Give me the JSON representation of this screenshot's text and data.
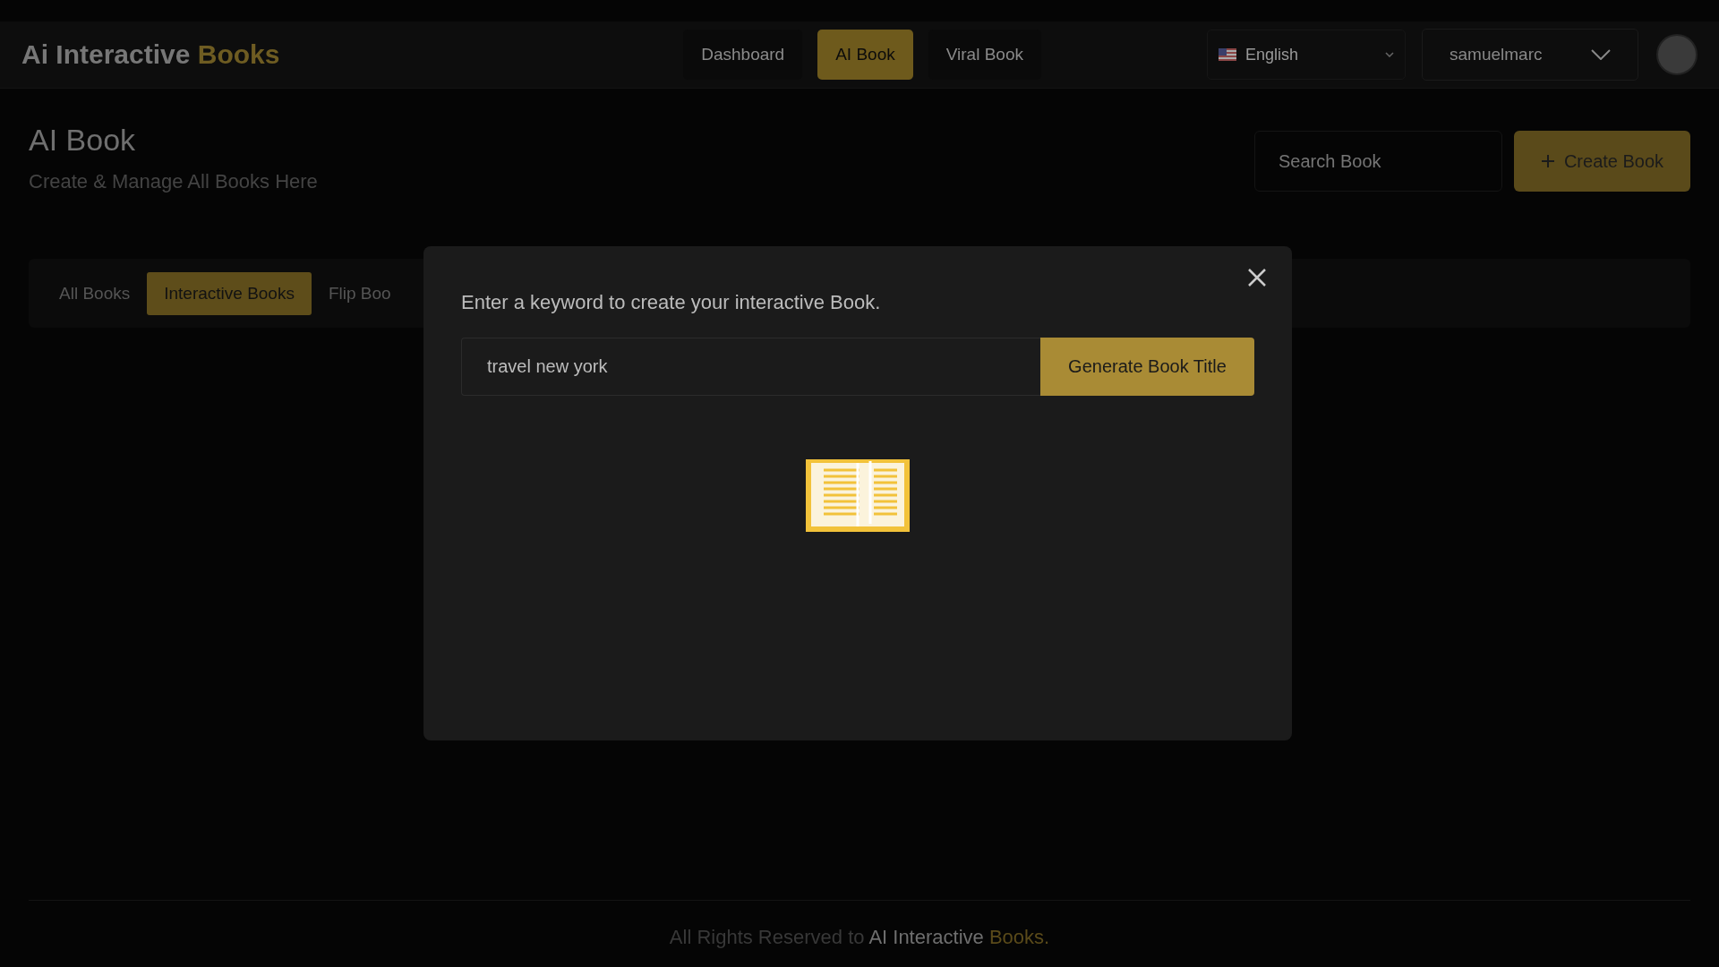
{
  "navbar": {
    "logo": {
      "text": "Ai Interactive",
      "highlight": "Books"
    },
    "links": [
      {
        "label": "Dashboard",
        "selected": false
      },
      {
        "label": "AI Book",
        "selected": true
      },
      {
        "label": "Viral Book",
        "selected": false
      }
    ],
    "language": {
      "value": "English"
    },
    "user": {
      "name": "samuelmarc"
    }
  },
  "header": {
    "title": "AI Book",
    "subtitle": "Create & Manage All Books Here",
    "search": {
      "placeholder": "Search Book"
    },
    "create_button": "Create Book"
  },
  "tabs": [
    {
      "label": "All Books",
      "selected": false
    },
    {
      "label": "Interactive Books",
      "selected": true
    },
    {
      "label": "Flip Boo",
      "selected": false
    }
  ],
  "modal": {
    "prompt": "Enter a keyword to create your interactive Book.",
    "keyword": {
      "value": "travel new york"
    },
    "button": "Generate Book Title"
  },
  "footer": {
    "text": "All Rights Reserved to",
    "brand": "AI Interactive",
    "highlight": "Books."
  }
}
